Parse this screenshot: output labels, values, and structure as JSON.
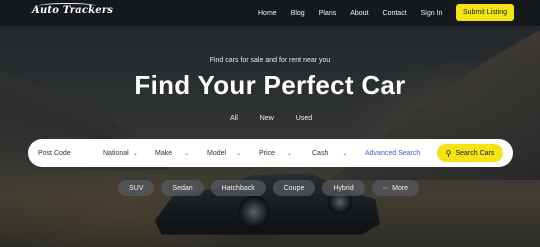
{
  "brand": {
    "logo_text": "Auto Trackers"
  },
  "nav": {
    "items": [
      "Home",
      "Blog",
      "Plans",
      "About",
      "Contact",
      "Sign In"
    ],
    "cta_label": "Submit Listing"
  },
  "hero": {
    "tagline": "Find cars for sale and for rent near you",
    "headline": "Find Your Perfect Car",
    "tabs": [
      "All",
      "New",
      "Used"
    ]
  },
  "search": {
    "postcode_placeholder": "Post Code",
    "national": "National",
    "make": "Make",
    "model": "Model",
    "price": "Price",
    "cash": "Cash",
    "advanced_label": "Advanced Search",
    "button_label": "Search Cars"
  },
  "chips": {
    "items": [
      "SUV",
      "Sedan",
      "Hatchback",
      "Coupe",
      "Hybrid"
    ],
    "more_label": "More"
  },
  "colors": {
    "accent": "#f4e315",
    "link": "#3b5bcc"
  }
}
